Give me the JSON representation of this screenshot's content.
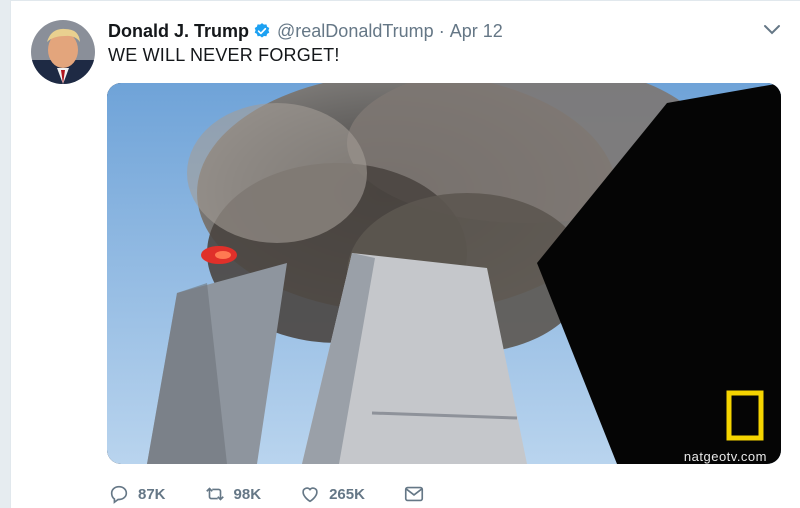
{
  "tweet": {
    "author_name": "Donald J. Trump",
    "handle": "@realDonaldTrump",
    "separator": "·",
    "date": "Apr 12",
    "text": "WE WILL NEVER FORGET!",
    "media": {
      "watermark": "natgeotv.com"
    },
    "actions": {
      "replies": "87K",
      "retweets": "98K",
      "likes": "265K"
    }
  },
  "icons": {
    "verified": "verified-badge-icon",
    "caret": "chevron-down-icon",
    "reply": "reply-icon",
    "retweet": "retweet-icon",
    "like": "heart-icon",
    "message": "envelope-icon"
  },
  "colors": {
    "verified_blue": "#1da1f2",
    "secondary_text": "#657786",
    "primary_text": "#14171a"
  }
}
